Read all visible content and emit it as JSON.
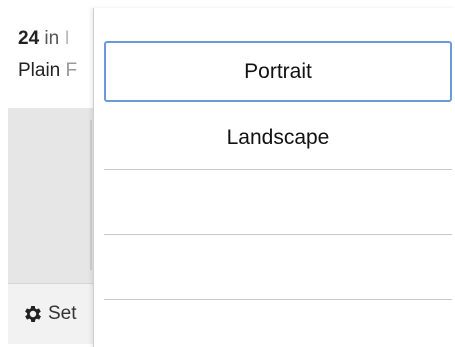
{
  "background": {
    "size_value": "24",
    "size_unit": "in",
    "size_cut": "I",
    "paper_type": "Plain",
    "paper_type_cut": "F",
    "settings_label": "Set"
  },
  "menu": {
    "options": [
      {
        "label": "Portrait",
        "selected": true
      },
      {
        "label": "Landscape",
        "selected": false
      },
      {
        "label": "",
        "selected": false
      },
      {
        "label": "",
        "selected": false
      }
    ]
  },
  "colors": {
    "selected_border": "#6a9bd8",
    "separator": "#c8c8c8",
    "background_band": "#e6e6e6"
  },
  "icons": {
    "settings": "gear-icon"
  }
}
